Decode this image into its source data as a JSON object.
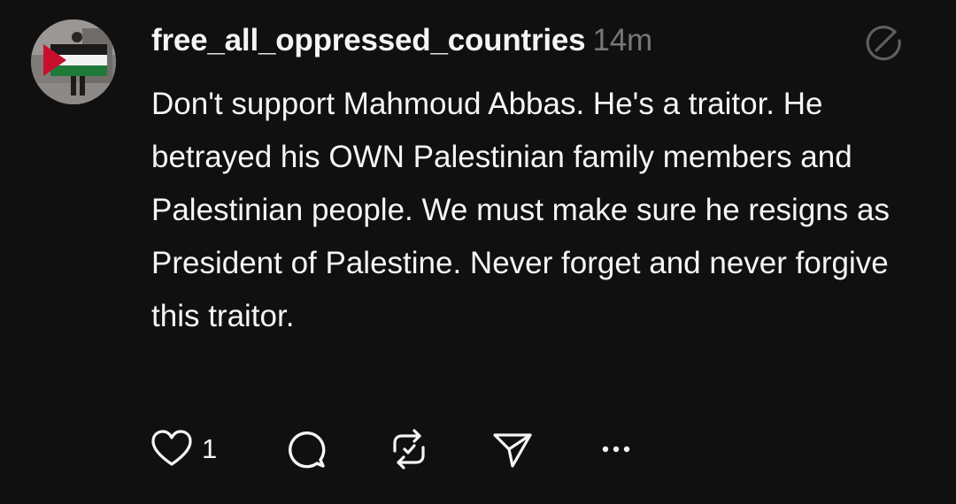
{
  "post": {
    "username": "free_all_oppressed_countries",
    "timestamp": "14m",
    "text": "Don't support Mahmoud Abbas. He's a traitor. He betrayed his OWN Palestinian family members and Palestinian people. We must make sure he resigns as President of Palestine. Never forget and never forgive this traitor.",
    "avatar_icon": "avatar-photo-with-palestinian-flag",
    "edit_icon": "edit-circle-icon"
  },
  "actions": {
    "like_icon": "heart-icon",
    "like_count": "1",
    "reply_icon": "comment-bubble-icon",
    "repost_icon": "repost-icon",
    "share_icon": "send-icon",
    "more_icon": "more-dots-icon"
  },
  "colors": {
    "background": "#101010",
    "text_primary": "#f3f5f7",
    "text_secondary": "#777777",
    "flag_red": "#c8102e",
    "flag_green": "#1f7a3a"
  }
}
